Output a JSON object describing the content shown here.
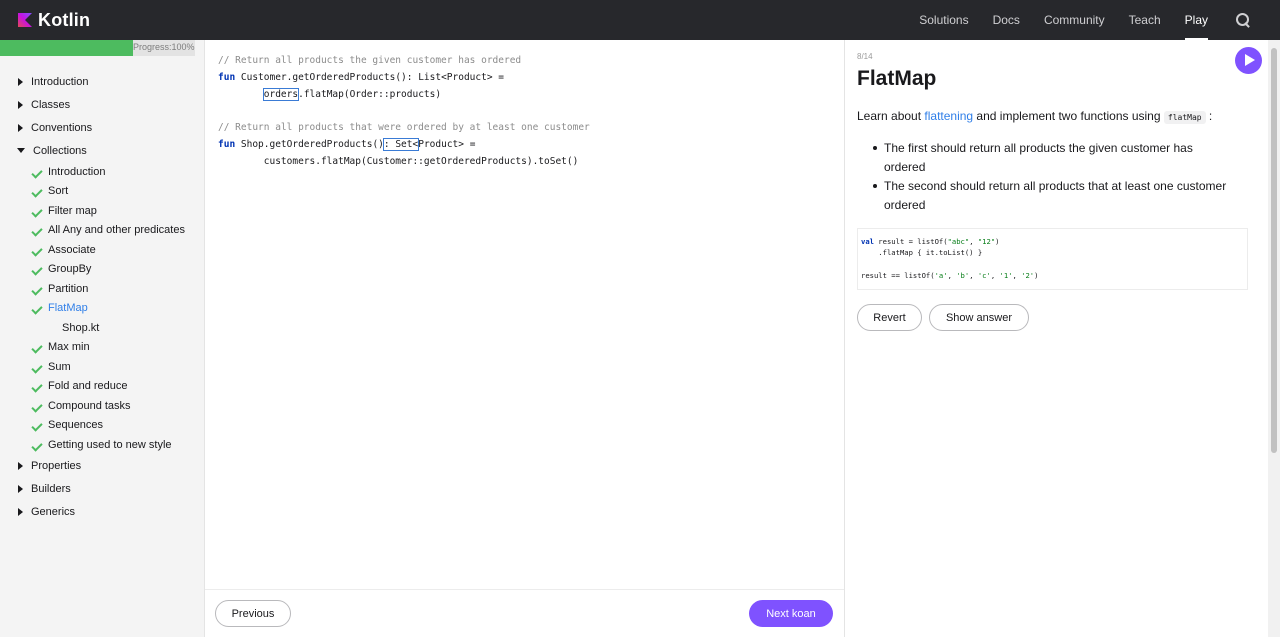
{
  "header": {
    "logo_text": "Kotlin",
    "nav": [
      "Solutions",
      "Docs",
      "Community",
      "Teach",
      "Play"
    ],
    "active_nav": "Play"
  },
  "sidebar": {
    "progress_label": "Progress:100%",
    "progress_value": 1.0,
    "sections_before": [
      "Introduction",
      "Classes",
      "Conventions"
    ],
    "expanded_section": "Collections",
    "collection_items": [
      "Introduction",
      "Sort",
      "Filter map",
      "All Any and other predicates",
      "Associate",
      "GroupBy",
      "Partition",
      "FlatMap",
      "Max min",
      "Sum",
      "Fold and reduce",
      "Compound tasks",
      "Sequences",
      "Getting used to new style"
    ],
    "active_item": "FlatMap",
    "active_file": "Shop.kt",
    "sections_after": [
      "Properties",
      "Builders",
      "Generics"
    ]
  },
  "editor": {
    "comment1": "// Return all products the given customer has ordered",
    "line1_kw": "fun",
    "line1_rest": " Customer.getOrderedProducts(): List<Product> =",
    "line2_indent": "        ",
    "line2_box": "orders",
    "line2_rest": ".flatMap(Order::products)",
    "comment2": "// Return all products that were ordered by at least one customer",
    "line3_kw": "fun",
    "line3_a": " Shop.getOrderedProducts()",
    "line3_box": ": Set<",
    "line3_b": "Product> =",
    "line4": "        customers.flatMap(Customer::getOrderedProducts).toSet()",
    "previous_label": "Previous",
    "next_label": "Next koan"
  },
  "task": {
    "step": "8/14",
    "title": "FlatMap",
    "intro_before": "Learn about ",
    "intro_link": "flattening",
    "intro_after": " and implement two functions using ",
    "intro_code": "flatMap",
    "intro_end": " :",
    "bullets": [
      "The first should return all products the given customer has ordered",
      "The second should return all products that at least one customer ordered"
    ],
    "example_kw": "val",
    "example_l1a": " result = listOf(",
    "example_s1": "\"abc\"",
    "example_l1b": ", ",
    "example_s2": "\"12\"",
    "example_l1c": ")",
    "example_l2": "    .flatMap { it.toList() }",
    "example_l3a": "result == listOf(",
    "example_c1": "'a'",
    "example_c2": "'b'",
    "example_c3": "'c'",
    "example_c4": "'1'",
    "example_c5": "'2'",
    "example_sep": ", ",
    "example_l3b": ")",
    "revert_label": "Revert",
    "show_answer_label": "Show answer"
  },
  "colors": {
    "accent": "#7f52ff",
    "link": "#307fe8",
    "check": "#4dbb5f",
    "nav_bg": "#27282c"
  }
}
